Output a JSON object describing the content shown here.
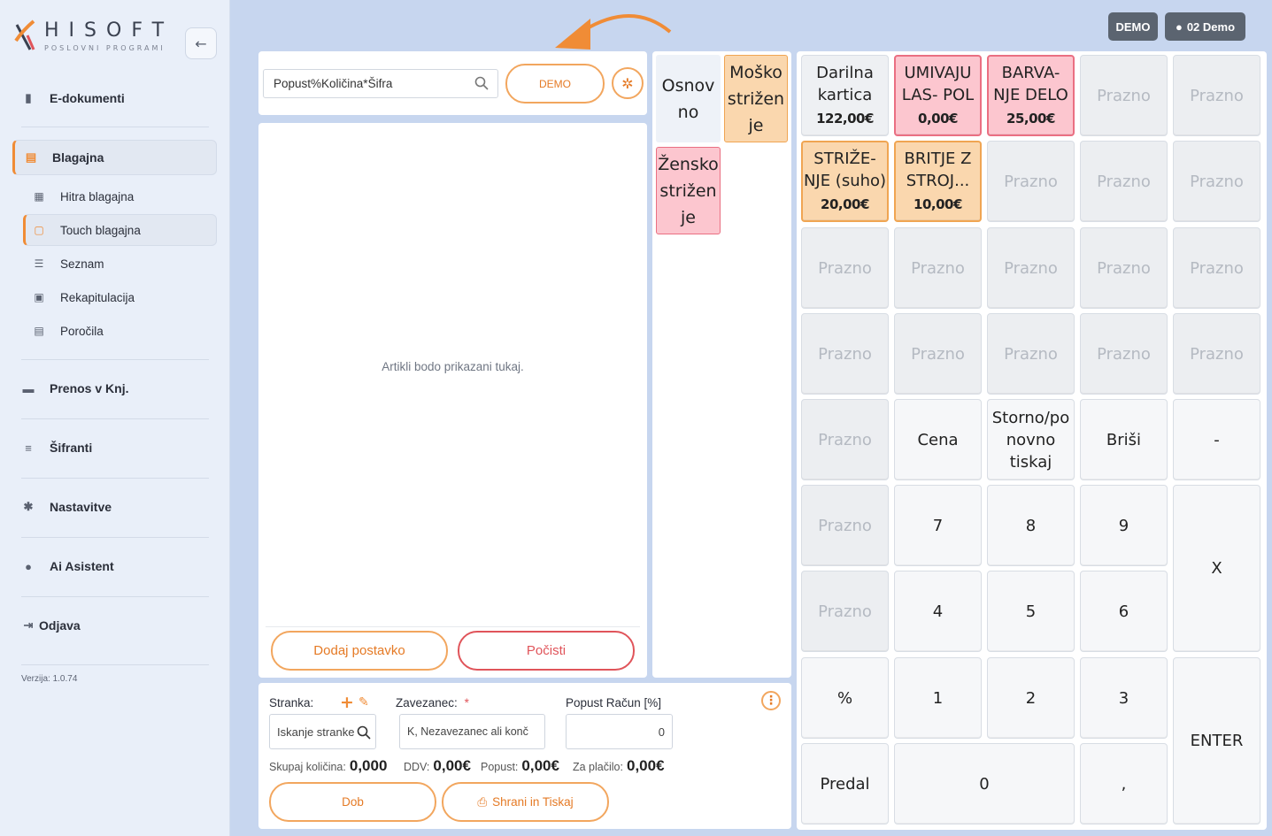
{
  "brand": {
    "name": "HISOFT",
    "tagline": "POSLOVNI PROGRAMI"
  },
  "sidebar": {
    "main_items": [
      {
        "label": "E-dokumenti",
        "icon": "document-icon"
      },
      {
        "label": "Blagajna",
        "icon": "cash-register-icon"
      },
      {
        "label": "Prenos v Knj.",
        "icon": "book-icon"
      },
      {
        "label": "Šifranti",
        "icon": "database-icon"
      },
      {
        "label": "Nastavitve",
        "icon": "gear-icon"
      },
      {
        "label": "Ai Asistent",
        "icon": "brain-icon"
      },
      {
        "label": "Odjava",
        "icon": "logout-icon"
      }
    ],
    "sub_items": [
      {
        "label": "Hitra blagajna",
        "icon": "register-icon"
      },
      {
        "label": "Touch blagajna",
        "icon": "touch-icon"
      },
      {
        "label": "Seznam",
        "icon": "list-icon"
      },
      {
        "label": "Rekapitulacija",
        "icon": "money-icon"
      },
      {
        "label": "Poročila",
        "icon": "report-icon"
      }
    ],
    "version": "Verzija: 1.0.74"
  },
  "topbar": {
    "demo_badge": "DEMO",
    "user_label": "02 Demo"
  },
  "article_panel": {
    "search_value": "Popust%Količina*Šifra",
    "demo_button": "DEMO",
    "empty_message": "Artikli bodo prikazani tukaj.",
    "add_button": "Dodaj postavko",
    "clear_button": "Počisti"
  },
  "customer_panel": {
    "customer_label": "Stranka:",
    "customer_placeholder": "Iskanje stranke",
    "taxpayer_label": "Zavezanec:",
    "taxpayer_required": "*",
    "taxpayer_value": "K, Nezavezanec ali konč",
    "discount_label": "Popust Račun [%]",
    "discount_value": "0",
    "total_qty_label": "Skupaj količina:",
    "total_qty_value": "0,000",
    "vat_label": "DDV:",
    "vat_value": "0,00€",
    "discount_total_label": "Popust:",
    "discount_total_value": "0,00€",
    "to_pay_label": "Za plačilo:",
    "to_pay_value": "0,00€",
    "delivery_button": "Dob",
    "save_print_button": "Shrani in Tiskaj"
  },
  "categories": [
    {
      "label": "Osnov no"
    },
    {
      "label": "Moško strižen je"
    },
    {
      "label": "Žensko strižen je"
    }
  ],
  "tiles": {
    "items": [
      {
        "name": "Darilna kartica",
        "price": "122,00€"
      },
      {
        "name": "UMIVAJU LAS- POL",
        "price": "0,00€"
      },
      {
        "name": "BARVA- NJE DELO",
        "price": "25,00€"
      },
      {
        "name": "STRIŽE- NJE (suho)",
        "price": "20,00€"
      },
      {
        "name": "BRITJE Z STROJ...",
        "price": "10,00€"
      }
    ],
    "empty_label": "Prazno",
    "keys": {
      "cena": "Cena",
      "storno": "Storno/po novno tiskaj",
      "brisi": "Briši",
      "minus": "-",
      "k7": "7",
      "k8": "8",
      "k9": "9",
      "x": "X",
      "k4": "4",
      "k5": "5",
      "k6": "6",
      "percent": "%",
      "k1": "1",
      "k2": "2",
      "k3": "3",
      "enter": "ENTER",
      "predal": "Predal",
      "k0": "0",
      "comma": ","
    }
  },
  "colors": {
    "accent": "#f08c36",
    "orange_tile": "#fad7ae",
    "pink_tile": "#fcc6cf",
    "danger": "#e0545a",
    "background": "#c7d6ef"
  }
}
